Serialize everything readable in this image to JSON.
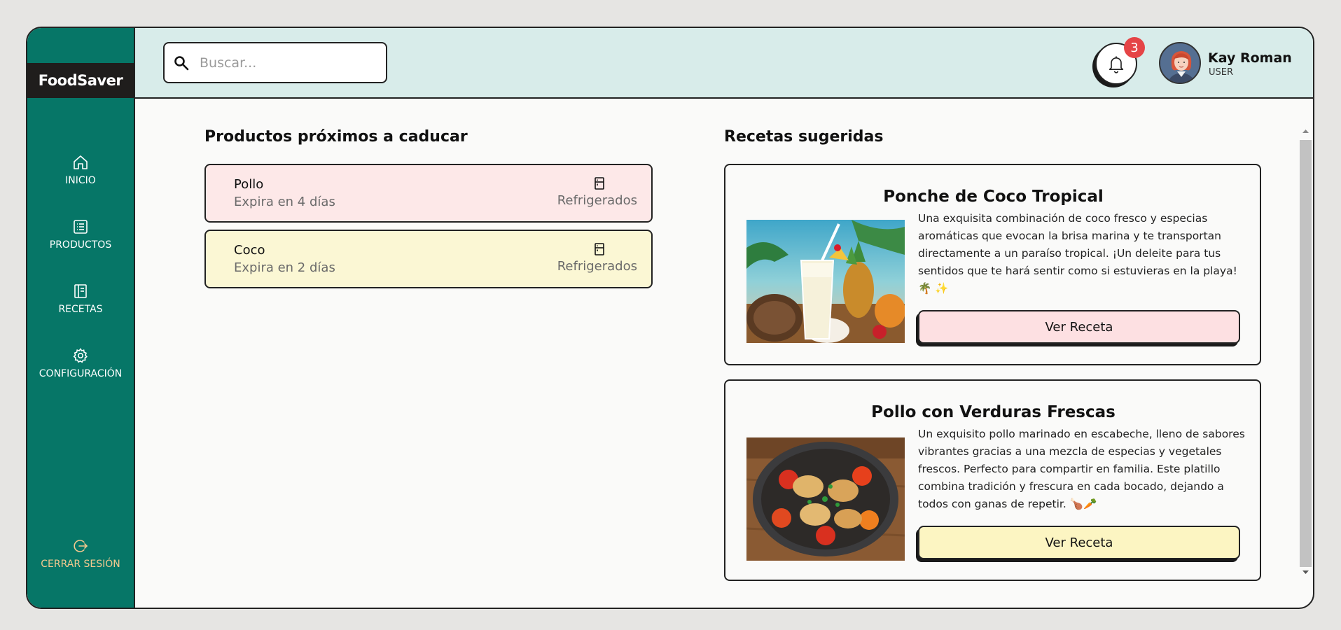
{
  "app": {
    "logo": "FoodSaver"
  },
  "sidebar": {
    "items": [
      {
        "label": "INICIO",
        "icon": "home-icon"
      },
      {
        "label": "PRODUCTOS",
        "icon": "list-icon"
      },
      {
        "label": "RECETAS",
        "icon": "book-icon"
      },
      {
        "label": "CONFIGURACIÓN",
        "icon": "gear-icon"
      }
    ],
    "logout": {
      "label": "CERRAR SESIÓN",
      "icon": "logout-icon"
    }
  },
  "header": {
    "search": {
      "placeholder": "Buscar..."
    },
    "notifications": {
      "count": "3",
      "icon": "bell-icon"
    },
    "user": {
      "name": "Kay Roman",
      "role": "USER"
    }
  },
  "expiring": {
    "title": "Productos próximos a caducar",
    "items": [
      {
        "name": "Pollo",
        "expires": "Expira en 4 días",
        "category": "Refrigerados",
        "color": "#fde8e8"
      },
      {
        "name": "Coco",
        "expires": "Expira en 2 días",
        "category": "Refrigerados",
        "color": "#fbf7d4"
      }
    ]
  },
  "recipes": {
    "title": "Recetas sugeridas",
    "items": [
      {
        "title": "Ponche de Coco Tropical",
        "description": "Una exquisita combinación de coco fresco y especias aromáticas que evocan la brisa marina y te transportan directamente a un paraíso tropical. ¡Un deleite para tus sentidos que te hará sentir como si estuvieras en la playa! 🌴 ✨",
        "button": "Ver Receta",
        "button_color": "#fde0e2"
      },
      {
        "title": "Pollo con Verduras Frescas",
        "description": "Un exquisito pollo marinado en escabeche, lleno de sabores vibrantes gracias a una mezcla de especias y vegetales frescos. Perfecto para compartir en familia. Este platillo combina tradición y frescura en cada bocado, dejando a todos con ganas de repetir. 🍗🥕",
        "button": "Ver Receta",
        "button_color": "#fcf5c2"
      }
    ]
  }
}
